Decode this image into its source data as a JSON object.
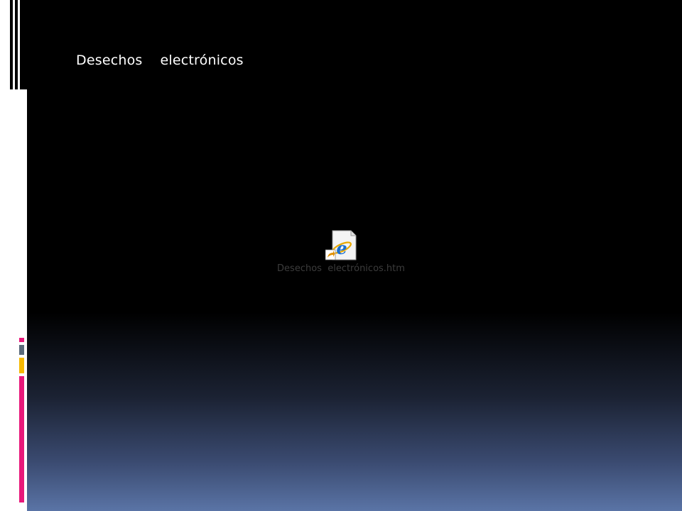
{
  "slide": {
    "title": "Desechos    electrónicos",
    "file": {
      "label": "Desechos  electrónicos.htm",
      "icon": "internet-explorer-shortcut-icon"
    }
  },
  "colors": {
    "background_top": "#000000",
    "background_bottom": "#5a74a6",
    "accent_magenta": "#e8187a",
    "accent_gray": "#5a6a7a",
    "accent_yellow": "#f5b800",
    "title_text": "#ffffff"
  }
}
